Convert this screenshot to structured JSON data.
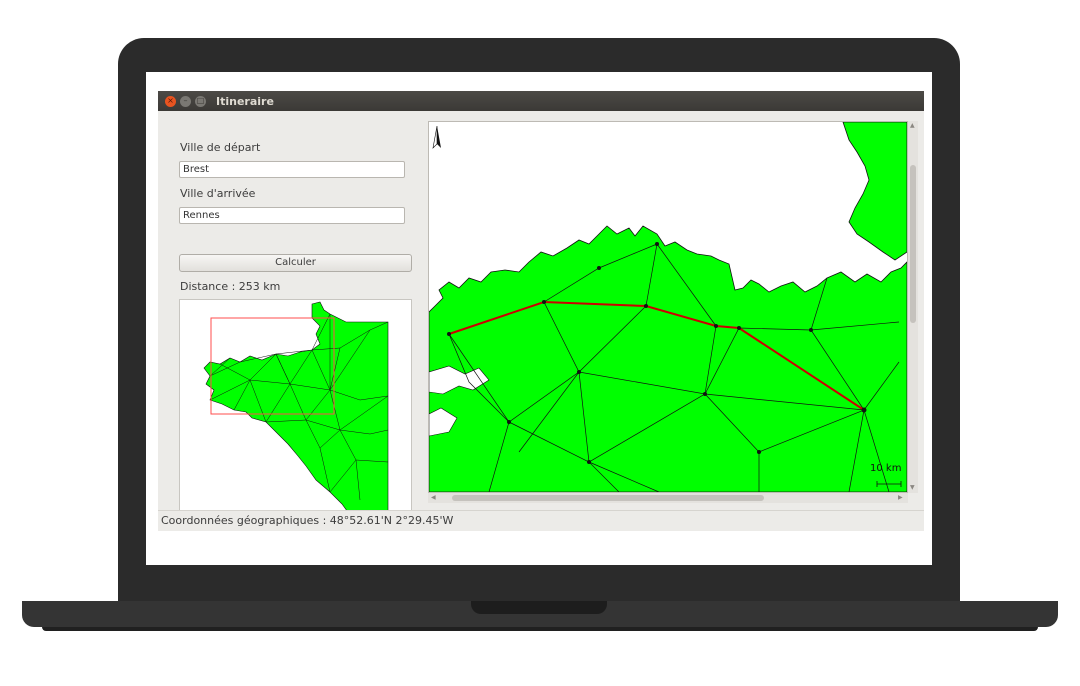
{
  "window": {
    "title": "Itineraire"
  },
  "form": {
    "departure_label": "Ville de départ",
    "departure_value": "Brest",
    "arrival_label": "Ville d'arrivée",
    "arrival_value": "Rennes",
    "calculate_label": "Calculer",
    "distance_text": "Distance : 253 km"
  },
  "map": {
    "scale_label": "10 km",
    "land_color": "#00ff00",
    "route_color": "#cc0000",
    "viewport_box_color": "#ff4444"
  },
  "status": {
    "coordinates_text": "Coordonnées géographiques : 48°52.61'N 2°29.45'W"
  },
  "icons": {
    "close": "close-icon",
    "minimize": "minimize-icon",
    "maximize": "maximize-icon",
    "north_arrow": "north-arrow-icon"
  }
}
